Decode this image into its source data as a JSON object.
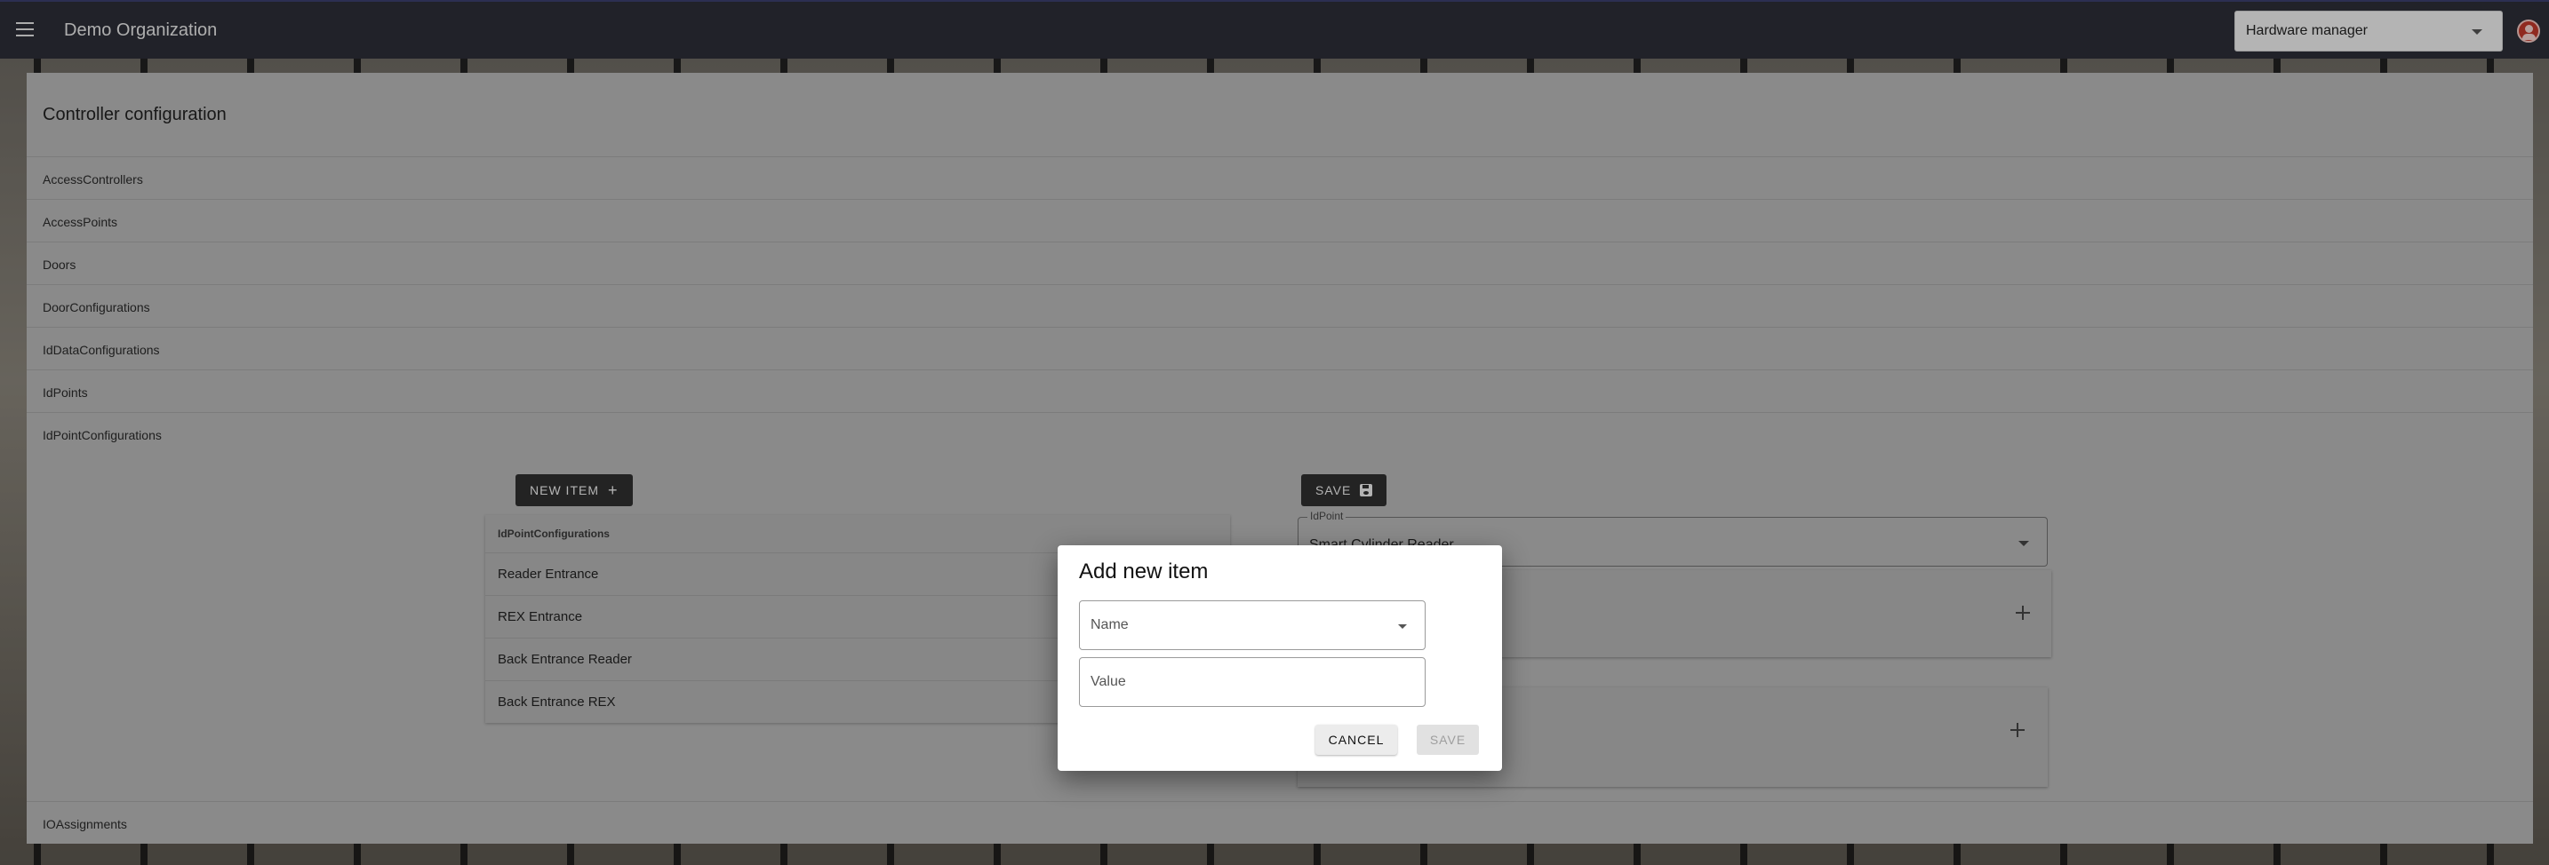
{
  "appbar": {
    "org_title": "Demo Organization",
    "role_select_value": "Hardware manager"
  },
  "card": {
    "title": "Controller configuration",
    "sections": [
      "AccessControllers",
      "AccessPoints",
      "Doors",
      "DoorConfigurations",
      "IdDataConfigurations",
      "IdPoints",
      "IdPointConfigurations"
    ],
    "footer_section": "IOAssignments"
  },
  "list": {
    "new_item_label": "NEW ITEM",
    "header": "IdPointConfigurations",
    "items": [
      "Reader Entrance",
      "REX Entrance",
      "Back Entrance Reader",
      "Back Entrance REX"
    ]
  },
  "editor": {
    "save_label": "SAVE",
    "idpoint_label": "IdPoint",
    "idpoint_value": "Smart Cylinder Reader"
  },
  "dialog": {
    "title": "Add new item",
    "name_placeholder": "Name",
    "value_placeholder": "Value",
    "cancel_label": "CANCEL",
    "save_label": "SAVE"
  },
  "colors": {
    "appbar": "#2c2e37",
    "avatar": "#c0392b",
    "dark_button": "#2f2f2f"
  }
}
